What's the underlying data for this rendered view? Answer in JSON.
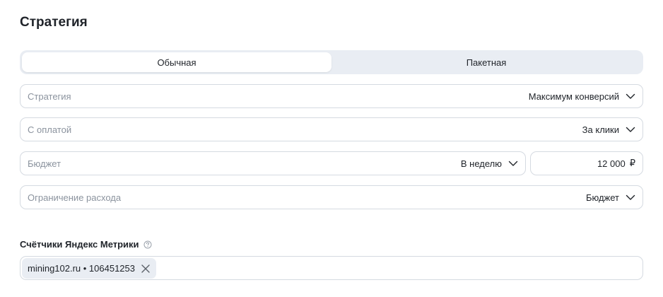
{
  "header": {
    "title": "Стратегия"
  },
  "mode_tabs": [
    {
      "label": "Обычная",
      "active": true
    },
    {
      "label": "Пакетная",
      "active": false
    }
  ],
  "fields": {
    "strategy": {
      "label": "Стратегия",
      "value": "Максимум конверсий"
    },
    "payment": {
      "label": "С оплатой",
      "value": "За клики"
    },
    "budget": {
      "label": "Бюджет",
      "period": "В неделю",
      "amount": "12 000",
      "currency": "₽"
    },
    "spend_limit": {
      "label": "Ограничение расхода",
      "value": "Бюджет"
    }
  },
  "metrika": {
    "title": "Счётчики Яндекс Метрики",
    "counters": [
      {
        "label": "mining102.ru • 106451253"
      }
    ]
  },
  "icons": {
    "dropdown": "chevron-down-icon",
    "help": "question-circle-icon",
    "remove": "close-icon"
  },
  "colors": {
    "segment_bg": "#e9edf3",
    "border": "#d5dae1",
    "placeholder_text": "#8b939e",
    "text": "#1f2329"
  }
}
